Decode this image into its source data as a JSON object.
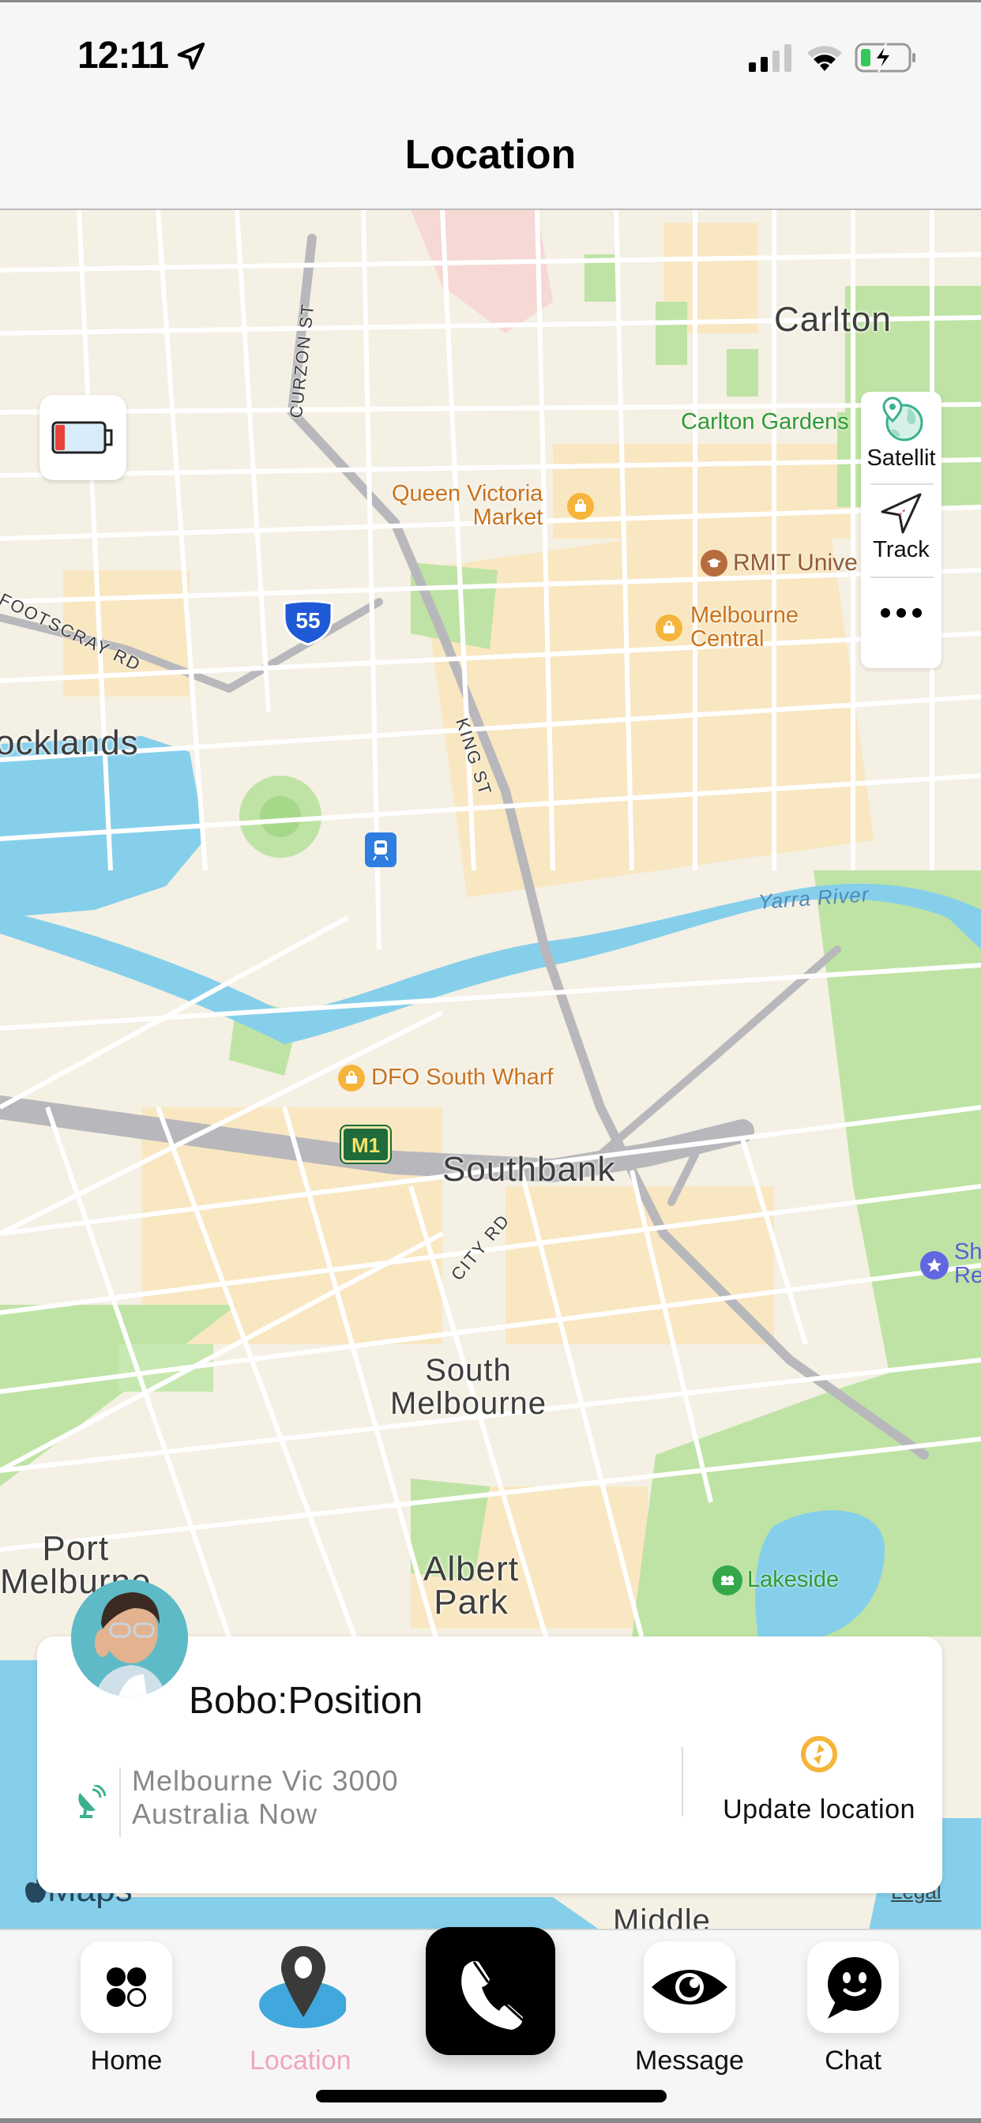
{
  "status_bar": {
    "time": "12:11",
    "location_icon": "location-arrow-icon",
    "signal_icon": "cellular-signal-icon",
    "wifi_icon": "wifi-icon",
    "battery_icon": "battery-charging-icon",
    "battery_color": "#34c759"
  },
  "header": {
    "title": "Location"
  },
  "map": {
    "area_labels": {
      "carlton": "Carlton",
      "docklands": "ocklands",
      "southbank": "Southbank",
      "south_melbourne": "South\nMelbourne",
      "port_melbourne": "Port\nMelburne",
      "albert_park": "Albert\nPark",
      "middle": "Middle"
    },
    "poi_labels": {
      "queen_victoria_market": "Queen Victoria\nMarket",
      "carlton_gardens": "Carlton Gardens",
      "rmit": "RMIT Unive",
      "melbourne_central": "Melbourne\nCentral",
      "dfo_south_wharf": "DFO South Wharf",
      "lakeside": "Lakeside",
      "shrine": "Sh\nRe"
    },
    "street_labels": {
      "curzon_st": "CURZON ST",
      "footscray_rd": "FOOTSCRAY RD",
      "king_st": "KING ST",
      "city_rd": "CITY RD"
    },
    "water_labels": {
      "yarra_river": "Yarra River"
    },
    "route_shields": {
      "route_55": "55",
      "route_m1": "M1"
    },
    "attribution": {
      "maps_label": "Maps",
      "legal_label": "Legal"
    }
  },
  "device_battery": {
    "level_fraction": 0.2,
    "fill_color": "#e8423b"
  },
  "tool_panel": {
    "items": [
      {
        "label": "Satellit",
        "icon": "satellite-globe-icon"
      },
      {
        "label": "Track",
        "icon": "track-arrow-icon"
      },
      {
        "label": "",
        "icon": "more-dots-icon"
      }
    ]
  },
  "info_card": {
    "title": "Bobo:Position",
    "address_line1": "Melbourne Vic 3000",
    "address_line2": "Australia Now",
    "source_icon": "satellite-antenna-icon",
    "update_label": "Update location",
    "update_icon": "refresh-icon",
    "accent_green": "#3bb08f",
    "accent_orange": "#f5b53a"
  },
  "tab_bar": {
    "tabs": [
      {
        "label": "Home",
        "icon": "home-dots-icon",
        "active": false
      },
      {
        "label": "Location",
        "icon": "location-pin-icon",
        "active": true
      },
      {
        "label": "",
        "icon": "phone-icon",
        "active": false
      },
      {
        "label": "Message",
        "icon": "eye-icon",
        "active": false
      },
      {
        "label": "Chat",
        "icon": "chat-bubble-icon",
        "active": false
      }
    ],
    "active_color": "#efa6be"
  }
}
